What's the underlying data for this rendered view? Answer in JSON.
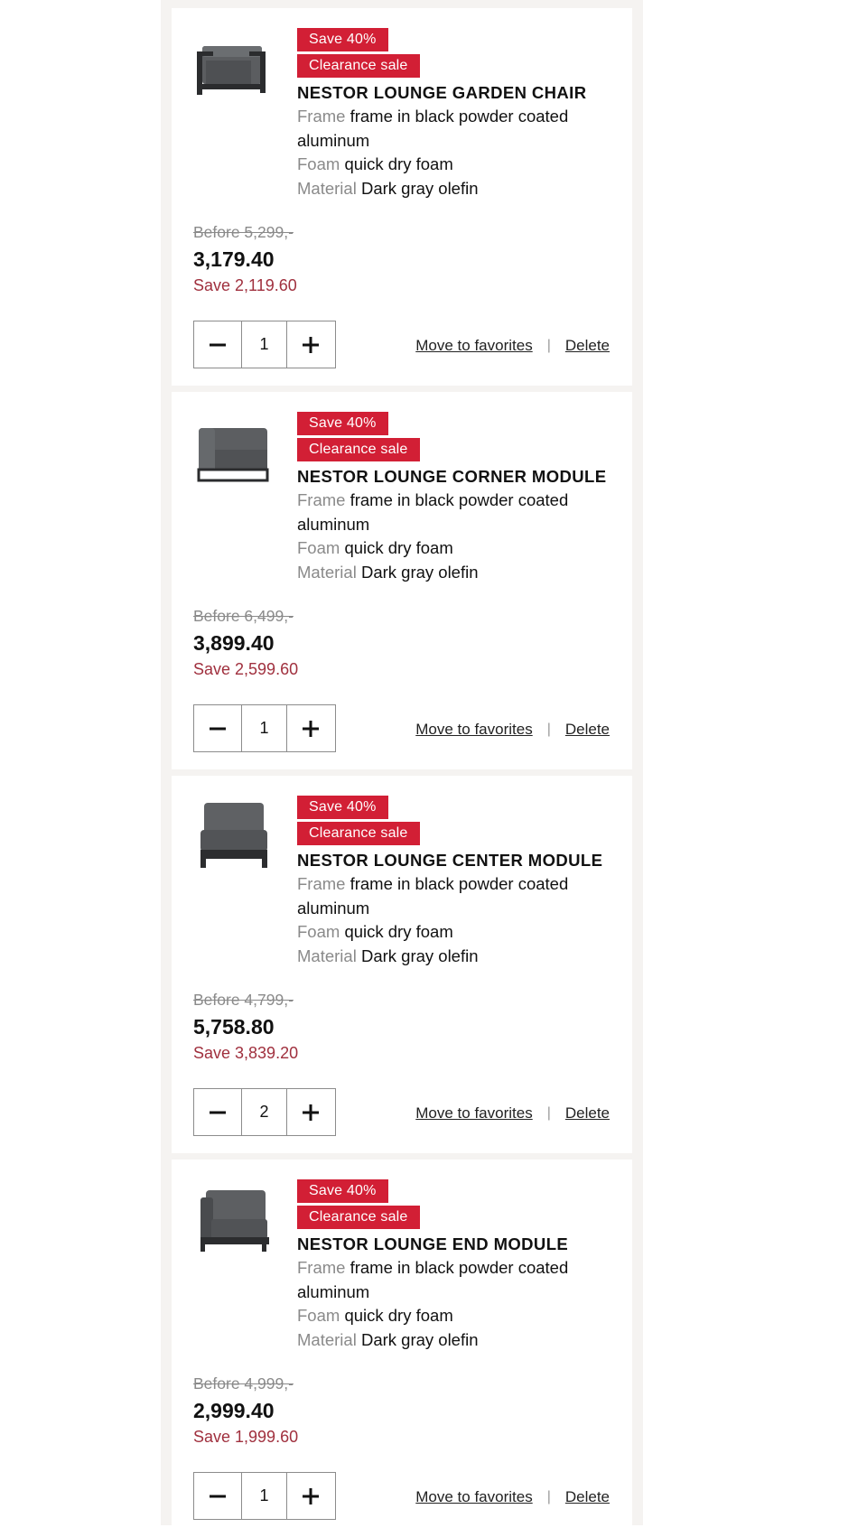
{
  "cart": {
    "items": [
      {
        "badges": [
          "Save 40%",
          "Clearance sale"
        ],
        "name": "NESTOR LOUNGE GARDEN CHAIR",
        "image": "armchair-image",
        "specs": [
          {
            "label": "Frame",
            "value": "frame in black powder coated"
          },
          {
            "label": "",
            "value": "aluminum"
          },
          {
            "label": "Foam",
            "value": "quick dry foam"
          },
          {
            "label": "Material",
            "value": "Dark gray olefin"
          }
        ],
        "before": "Before 5,299,-",
        "price": "3,179.40",
        "save": "Save 2,119.60",
        "quantity": "1",
        "move_label": "Move to favorites",
        "delete_label": "Delete"
      },
      {
        "badges": [
          "Save 40%",
          "Clearance sale"
        ],
        "name": "NESTOR LOUNGE CORNER MODULE",
        "image": "corner-module-image",
        "specs": [
          {
            "label": "Frame",
            "value": "frame in black powder coated"
          },
          {
            "label": "",
            "value": "aluminum"
          },
          {
            "label": "Foam",
            "value": "quick dry foam"
          },
          {
            "label": "Material",
            "value": "Dark gray olefin"
          }
        ],
        "before": "Before 6,499,-",
        "price": "3,899.40",
        "save": "Save 2,599.60",
        "quantity": "1",
        "move_label": "Move to favorites",
        "delete_label": "Delete"
      },
      {
        "badges": [
          "Save 40%",
          "Clearance sale"
        ],
        "name": "NESTOR LOUNGE CENTER MODULE",
        "image": "center-module-image",
        "specs": [
          {
            "label": "Frame",
            "value": "frame in black powder coated"
          },
          {
            "label": "",
            "value": "aluminum"
          },
          {
            "label": "Foam",
            "value": "quick dry foam"
          },
          {
            "label": "Material",
            "value": "Dark gray olefin"
          }
        ],
        "before": "Before 4,799,-",
        "price": "5,758.80",
        "save": "Save 3,839.20",
        "quantity": "2",
        "move_label": "Move to favorites",
        "delete_label": "Delete"
      },
      {
        "badges": [
          "Save 40%",
          "Clearance sale"
        ],
        "name": "NESTOR LOUNGE END MODULE",
        "image": "end-module-image",
        "specs": [
          {
            "label": "Frame",
            "value": "frame in black powder coated"
          },
          {
            "label": "",
            "value": "aluminum"
          },
          {
            "label": "Foam",
            "value": "quick dry foam"
          },
          {
            "label": "Material",
            "value": "Dark gray olefin"
          }
        ],
        "before": "Before 4,999,-",
        "price": "2,999.40",
        "save": "Save 1,999.60",
        "quantity": "1",
        "move_label": "Move to favorites",
        "delete_label": "Delete"
      }
    ],
    "icons": {
      "decrement": "minus-icon",
      "increment": "plus-icon"
    },
    "colors": {
      "badge": "#d21f35",
      "save_text": "#a0303e",
      "muted": "#8a8a8a",
      "page_bg": "#f5f3f1"
    }
  }
}
